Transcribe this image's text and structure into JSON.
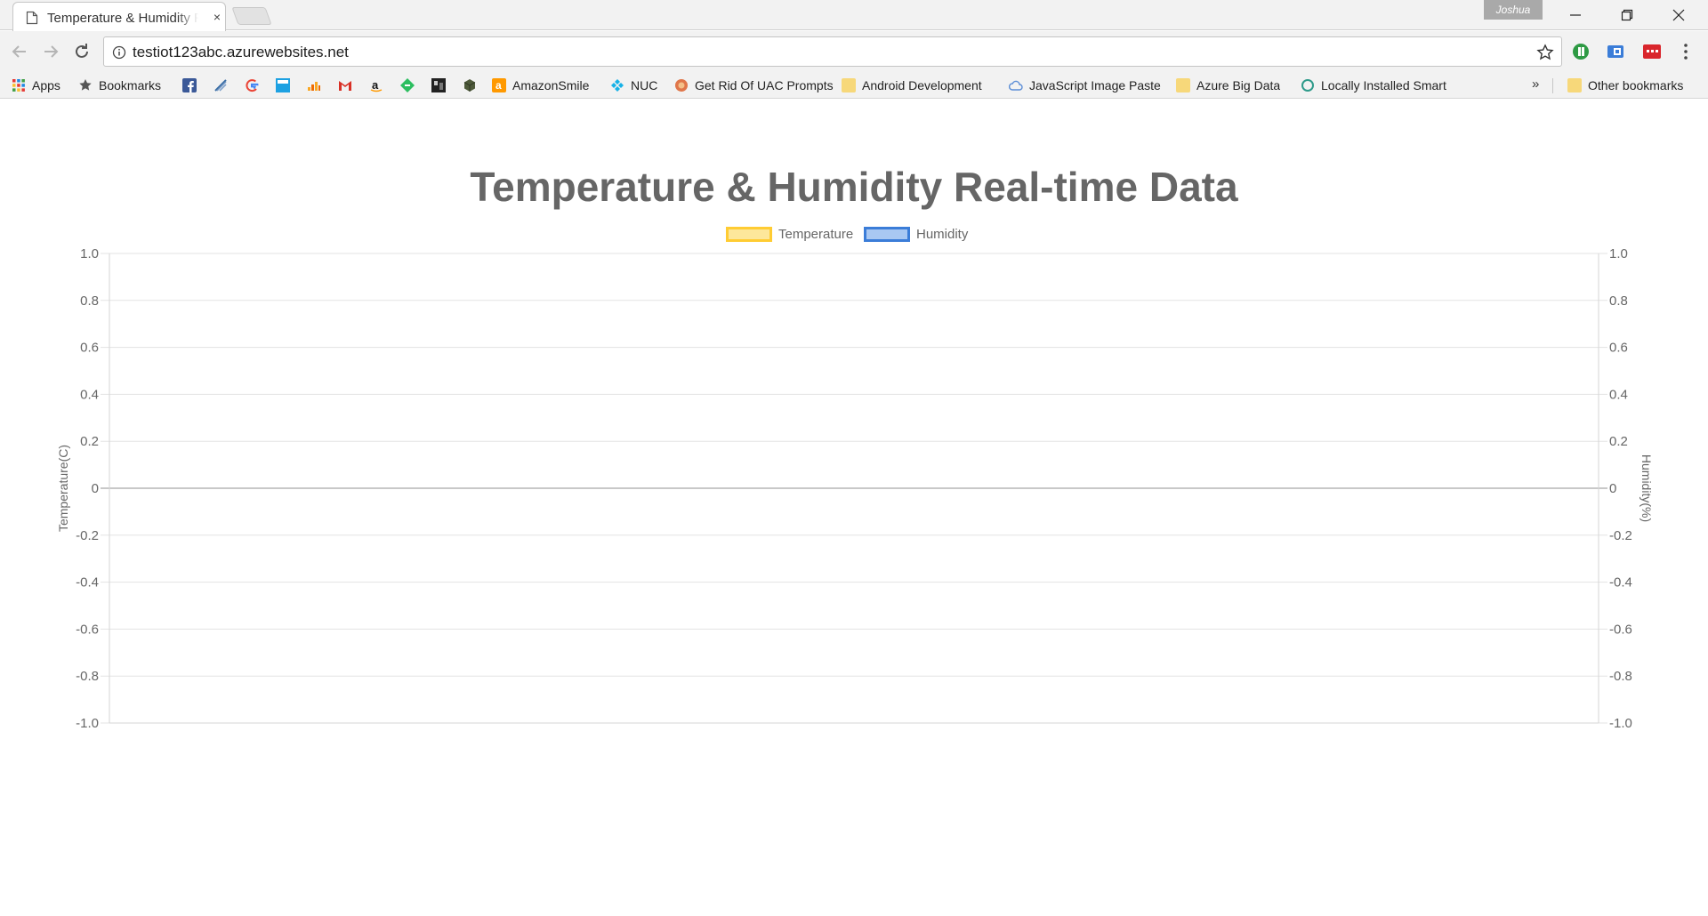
{
  "browser": {
    "tab": {
      "title": "Temperature & Humidity Real-time Data",
      "close": "×"
    },
    "profile_name": "Joshua",
    "url": "testiot123abc.azurewebsites.net",
    "bookmarks": [
      {
        "label": "Apps",
        "icon": "apps-grid-icon"
      },
      {
        "label": "Bookmarks",
        "icon": "star-icon"
      },
      {
        "label": "AmazonSmile",
        "icon": "amazon-smile-icon"
      },
      {
        "label": "NUC",
        "icon": "kodi-icon"
      },
      {
        "label": "Get Rid Of UAC Prompts",
        "icon": "uac-icon"
      },
      {
        "label": "Android Development",
        "icon": "folder-icon"
      },
      {
        "label": "JavaScript Image Paste",
        "icon": "cloud-icon"
      },
      {
        "label": "Azure Big Data",
        "icon": "folder-icon"
      },
      {
        "label": "Locally Installed Smart",
        "icon": "circle-icon"
      }
    ],
    "bookmarks_overflow": "»",
    "other_bookmarks": "Other bookmarks",
    "colors": {
      "chrome_bg": "#f2f2f2",
      "accent_green": "#2e9a44",
      "accent_blue": "#3b7dd8",
      "accent_red": "#d9262c"
    }
  },
  "chart_data": {
    "type": "line",
    "title": "Temperature & Humidity Real-time Data",
    "series": [
      {
        "name": "Temperature",
        "values": [],
        "axis": "left",
        "color": "#ffcc33"
      },
      {
        "name": "Humidity",
        "values": [],
        "axis": "right",
        "color": "#3b7dd8"
      }
    ],
    "x": [],
    "ylabel_left": "Temperature(C)",
    "ylabel_right": "Humidity(%)",
    "ylim": [
      -1.0,
      1.0
    ],
    "y_ticks": [
      "1.0",
      "0.8",
      "0.6",
      "0.4",
      "0.2",
      "0",
      "-0.2",
      "-0.4",
      "-0.6",
      "-0.8",
      "-1.0"
    ],
    "legend_position": "top-center",
    "grid": true
  }
}
